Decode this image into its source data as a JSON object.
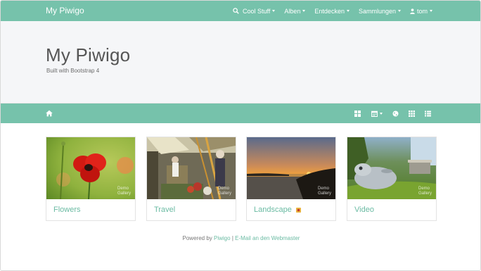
{
  "navbar": {
    "brand": "My Piwigo",
    "items": [
      {
        "label": "Cool Stuff"
      },
      {
        "label": "Alben"
      },
      {
        "label": "Entdecken"
      },
      {
        "label": "Sammlungen"
      },
      {
        "label": "tom"
      }
    ]
  },
  "jumbotron": {
    "title": "My Piwigo",
    "subtitle": "Built with Bootstrap 4"
  },
  "albums": [
    {
      "title": "Flowers",
      "watermark_line1": "Demo",
      "watermark_line2": "Gallery"
    },
    {
      "title": "Travel",
      "watermark_line1": "Demo",
      "watermark_line2": "Gallery"
    },
    {
      "title": "Landscape",
      "watermark_line1": "Demo",
      "watermark_line2": "Gallery"
    },
    {
      "title": "Video",
      "watermark_line1": "Demo",
      "watermark_line2": "Gallery"
    }
  ],
  "footer": {
    "powered_by": "Powered by",
    "piwigo_link": "Piwigo",
    "separator": "|",
    "email_link": "E-Mail an den Webmaster"
  },
  "colors": {
    "accent": "#76c2ab",
    "link": "#6bbba3",
    "jumbotron_bg": "#f5f6f8"
  },
  "icons": {
    "search": "search-icon",
    "user": "user-icon",
    "home": "home-icon",
    "grid": "grid-icon",
    "calendar": "calendar-icon",
    "globe": "globe-icon",
    "thumbnails": "thumbnails-icon",
    "list": "list-icon",
    "new_badge": "new-badge-icon"
  }
}
